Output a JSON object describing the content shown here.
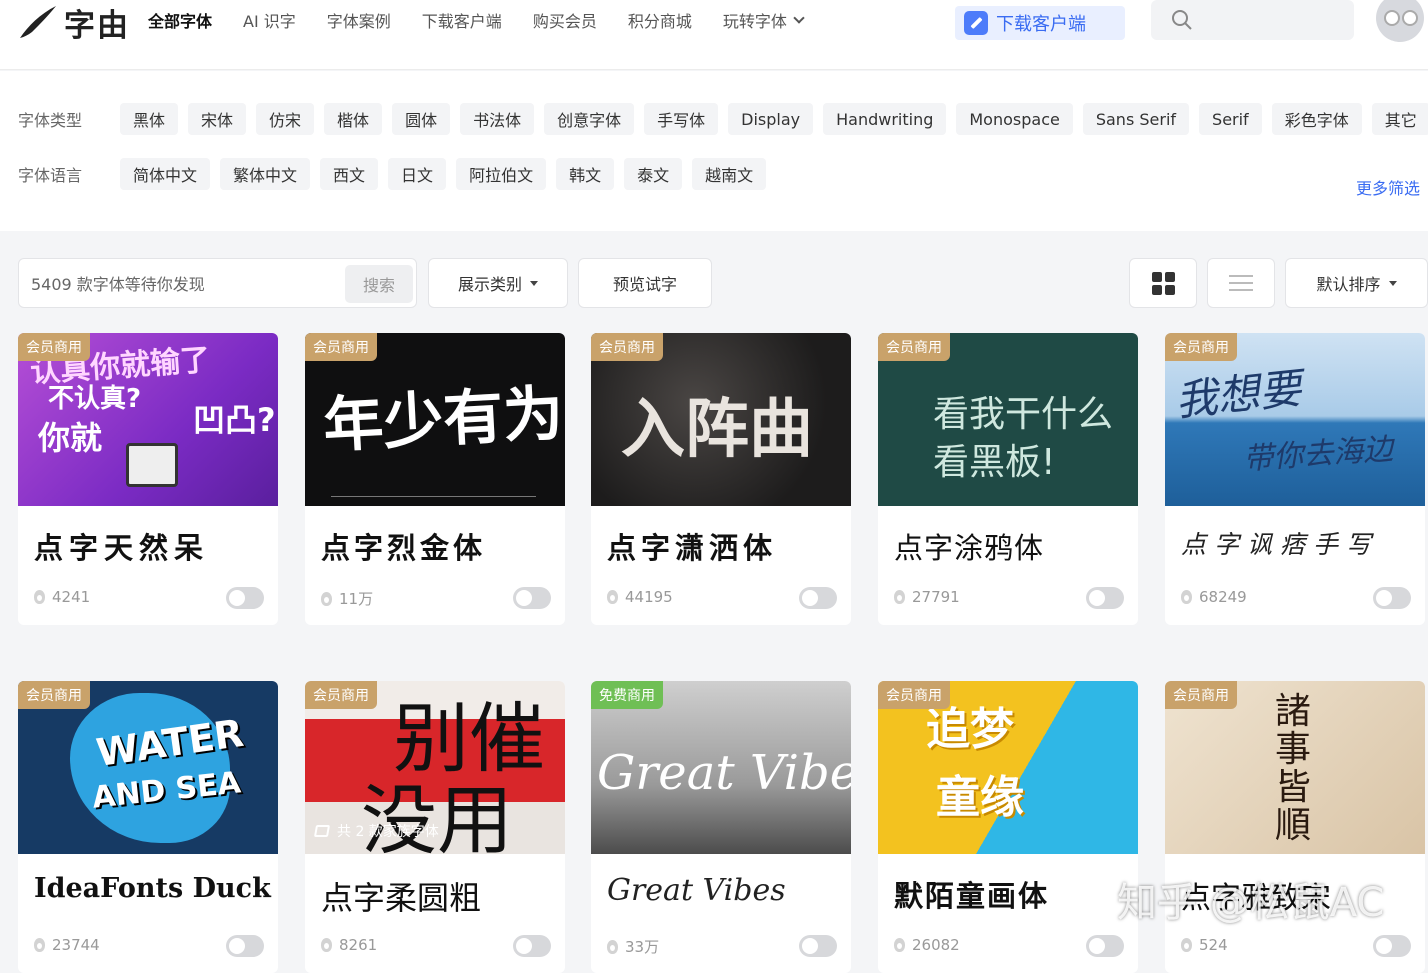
{
  "app": {
    "logo_text": "字由"
  },
  "nav": [
    "全部字体",
    "AI 识字",
    "字体案例",
    "下载客户端",
    "购买会员",
    "积分商城",
    "玩转字体"
  ],
  "header": {
    "download_label": "下载客户端"
  },
  "filters": {
    "type_label": "字体类型",
    "types": [
      "黑体",
      "宋体",
      "仿宋",
      "楷体",
      "圆体",
      "书法体",
      "创意字体",
      "手写体",
      "Display",
      "Handwriting",
      "Monospace",
      "Sans Serif",
      "Serif",
      "彩色字体",
      "其它"
    ],
    "lang_label": "字体语言",
    "langs": [
      "简体中文",
      "繁体中文",
      "西文",
      "日文",
      "阿拉伯文",
      "韩文",
      "泰文",
      "越南文"
    ],
    "more_label": "更多筛选"
  },
  "toolbar": {
    "search_placeholder": "5409 款字体等待你发现",
    "search_button": "搜索",
    "display_category": "展示类别",
    "preview": "预览试字",
    "sort": "默认排序"
  },
  "colors": {
    "accent": "#3a6cf2",
    "member_badge": "#c9a26a",
    "free_badge": "#6fbf55"
  },
  "cards": [
    {
      "badge": "会员商用",
      "name": "点字天然呆",
      "count": "4241",
      "img_lines": [
        "认真你就输了",
        "不认真?",
        "你就",
        "凹凸?"
      ]
    },
    {
      "badge": "会员商用",
      "name": "点字烈金体",
      "count": "11万",
      "img_lines": [
        "年少有为"
      ]
    },
    {
      "badge": "会员商用",
      "name": "点字潇洒体",
      "count": "44195",
      "img_lines": [
        "入阵曲"
      ]
    },
    {
      "badge": "会员商用",
      "name": "点字涂鸦体",
      "count": "27791",
      "img_lines": [
        "看我干什么",
        "看黑板!"
      ]
    },
    {
      "badge": "会员商用",
      "name": "点字讽痞手写",
      "count": "68249",
      "img_lines": [
        "我想要",
        "带你去海边"
      ]
    },
    {
      "badge": "会员商用",
      "name": "IdeaFonts Duck",
      "count": "23744",
      "img_lines": [
        "WATER",
        "AND SEA"
      ]
    },
    {
      "badge": "会员商用",
      "name": "点字柔圆粗",
      "count": "8261",
      "img_lines": [
        "别催",
        "没用"
      ],
      "family": "共 2 款家族字体"
    },
    {
      "badge": "免费商用",
      "name": "Great Vibes",
      "count": "33万",
      "img_lines": [
        "Great Vibes"
      ]
    },
    {
      "badge": "会员商用",
      "name": "默陌童画体",
      "count": "26082",
      "img_lines": [
        "追梦",
        "童缘"
      ]
    },
    {
      "badge": "会员商用",
      "name": "点字雅致宋",
      "count": "524",
      "img_lines": [
        "諸事皆順"
      ]
    }
  ],
  "watermark": "知乎 @松鼠AC"
}
